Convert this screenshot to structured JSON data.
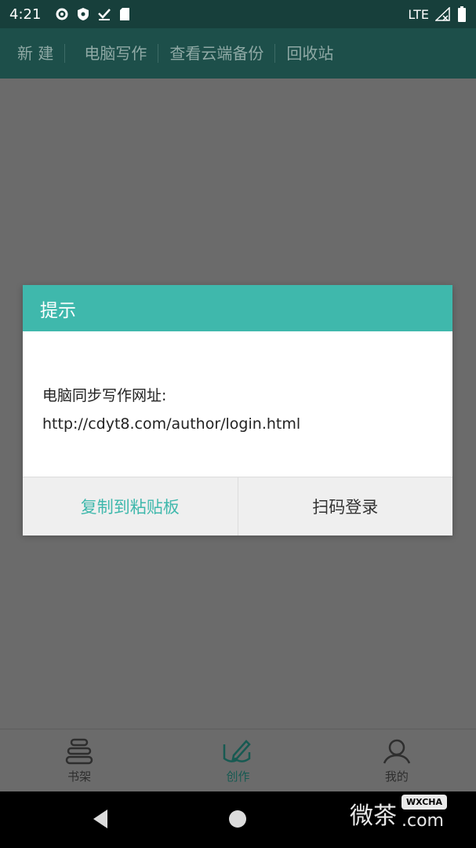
{
  "status_bar": {
    "time": "4:21",
    "network": "LTE"
  },
  "top_tabs": [
    "新 建",
    "电脑写作",
    "查看云端备份",
    "回收站"
  ],
  "dialog": {
    "title": "提示",
    "body_line1": "电脑同步写作网址:",
    "body_line2": "http://cdyt8.com/author/login.html",
    "copy_button": "复制到粘贴板",
    "scan_button": "扫码登录"
  },
  "bottom_nav": [
    {
      "label": "书架",
      "icon": "bookshelf-icon",
      "active": false
    },
    {
      "label": "创作",
      "icon": "write-icon",
      "active": true
    },
    {
      "label": "我的",
      "icon": "profile-icon",
      "active": false
    }
  ],
  "watermark": {
    "text": "微茶",
    "badge": "WXCHA",
    "suffix": ".com"
  },
  "colors": {
    "accent": "#3fb8ac",
    "header": "#1d4f4a",
    "status_bar": "#173f3b"
  }
}
